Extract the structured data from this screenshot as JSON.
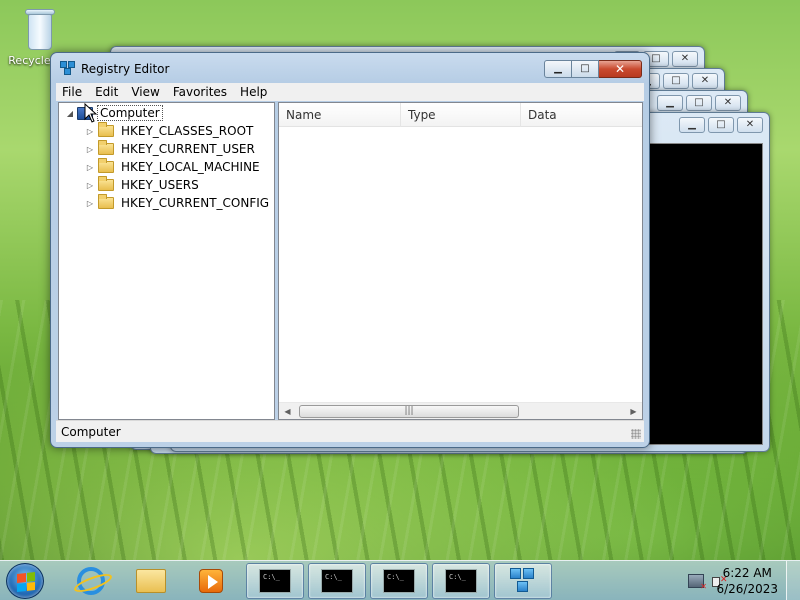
{
  "desktop": {
    "recycle_bin_label": "Recycle Bin"
  },
  "window": {
    "title": "Registry Editor",
    "controls": {
      "minimize": "▁",
      "maximize": "□",
      "close": "✕"
    }
  },
  "menu": {
    "items": [
      "File",
      "Edit",
      "View",
      "Favorites",
      "Help"
    ]
  },
  "tree": {
    "root": "Computer",
    "children": [
      "HKEY_CLASSES_ROOT",
      "HKEY_CURRENT_USER",
      "HKEY_LOCAL_MACHINE",
      "HKEY_USERS",
      "HKEY_CURRENT_CONFIG"
    ]
  },
  "list": {
    "columns": [
      "Name",
      "Type",
      "Data"
    ]
  },
  "status": {
    "text": "Computer"
  },
  "taskbar": {
    "cmd_label": "C:\\_",
    "clock_time": "6:22 AM",
    "clock_date": "6/26/2023"
  },
  "colors": {
    "close_button": "#c94a2f",
    "desktop": "#8cc85a"
  }
}
